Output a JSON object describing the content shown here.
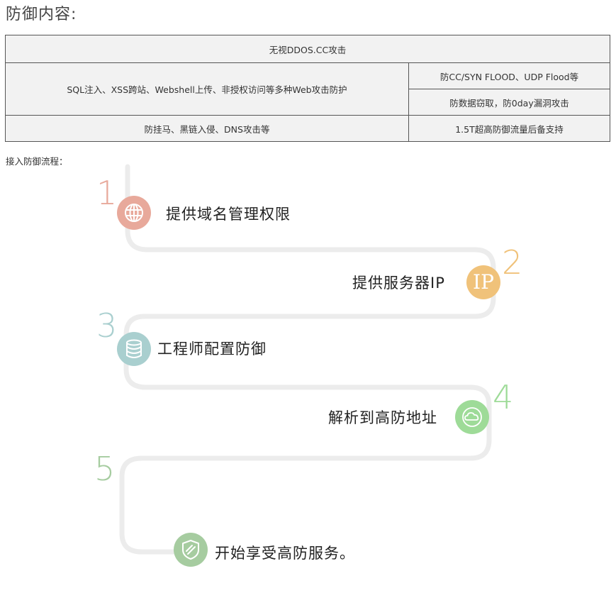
{
  "page": {
    "title": "防御内容:"
  },
  "table": {
    "row1": "无视DDOS.CC攻击",
    "row2_left": "SQL注入、XSS跨站、Webshell上传、非授权访问等多种Web攻击防护",
    "row2_right_top": "防CC/SYN FLOOD、UDP Flood等",
    "row2_right_bottom": "防数据窃取，防0day漏洞攻击",
    "row3_left": "防挂马、黑链入侵、DNS攻击等",
    "row3_right": "1.5T超高防御流量后备支持"
  },
  "flow": {
    "label": "接入防御流程：",
    "steps": [
      {
        "num": "1",
        "text": "提供域名管理权限",
        "icon": "globe-icon",
        "color": "#e8a99b"
      },
      {
        "num": "2",
        "text": "提供服务器IP",
        "icon": "ip-icon",
        "icon_text": "IP",
        "color": "#f0c27a"
      },
      {
        "num": "3",
        "text": "工程师配置防御",
        "icon": "database-icon",
        "color": "#a9cfcf"
      },
      {
        "num": "4",
        "text": "解析到高防地址",
        "icon": "cloud-icon",
        "color": "#9edb98"
      },
      {
        "num": "5",
        "text": "开始享受高防服务。",
        "icon": "shield-icon",
        "color": "#a6cca0"
      }
    ]
  }
}
